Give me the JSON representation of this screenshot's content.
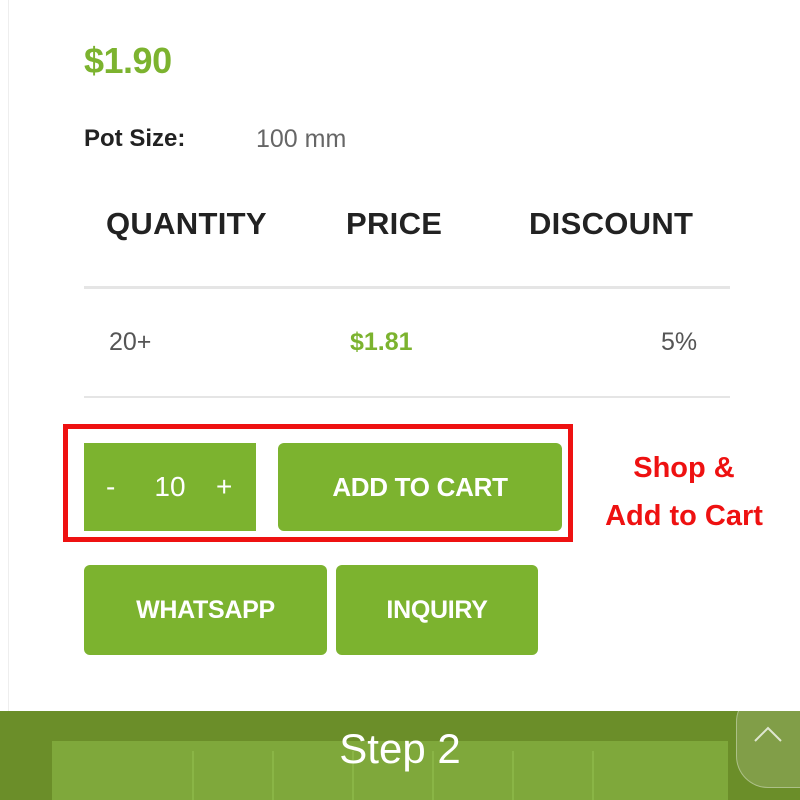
{
  "product": {
    "price": "$1.90",
    "pot_size": {
      "label": "Pot Size:",
      "value": "100 mm"
    }
  },
  "pricing_table": {
    "headers": [
      "QUANTITY",
      "PRICE",
      "DISCOUNT"
    ],
    "rows": [
      {
        "quantity": "20+",
        "price": "$1.81",
        "discount": "5%"
      }
    ]
  },
  "cart": {
    "decrement": "-",
    "quantity": "10",
    "increment": "+",
    "add_to_cart": "ADD TO CART"
  },
  "actions": {
    "whatsapp": "WHATSAPP",
    "inquiry": "INQUIRY"
  },
  "annotation": {
    "line1": "Shop &",
    "line2": "Add to Cart"
  },
  "footer": {
    "title": "Step 2"
  },
  "icons": {
    "scroll_top": "chevron-up-icon"
  },
  "colors": {
    "brand_green": "#7cb32f",
    "annotation_red": "#ee1111",
    "footer_green": "#6b8e29"
  }
}
